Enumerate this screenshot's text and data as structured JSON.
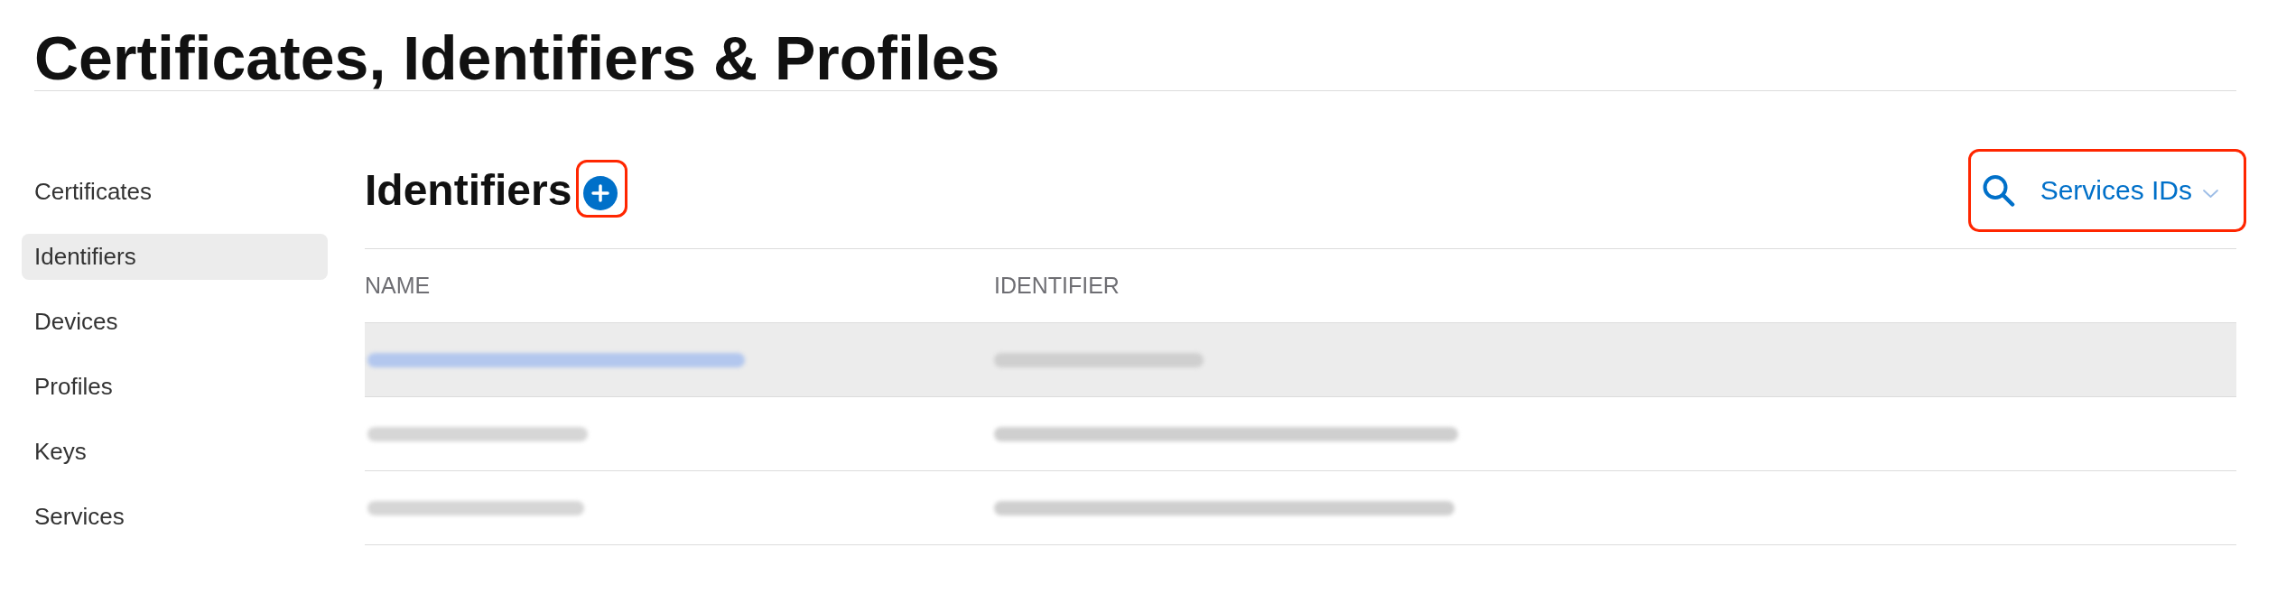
{
  "page_title": "Certificates, Identifiers & Profiles",
  "sidebar": {
    "items": [
      {
        "label": "Certificates",
        "selected": false
      },
      {
        "label": "Identifiers",
        "selected": true
      },
      {
        "label": "Devices",
        "selected": false
      },
      {
        "label": "Profiles",
        "selected": false
      },
      {
        "label": "Keys",
        "selected": false
      },
      {
        "label": "Services",
        "selected": false
      }
    ]
  },
  "section": {
    "title": "Identifiers",
    "add_button": {
      "highlighted": true
    }
  },
  "filter": {
    "highlighted": true,
    "selected_type": "Services IDs"
  },
  "table": {
    "columns": [
      "NAME",
      "IDENTIFIER"
    ],
    "rows": [
      {
        "selected": true
      },
      {
        "selected": false
      },
      {
        "selected": false
      }
    ]
  }
}
